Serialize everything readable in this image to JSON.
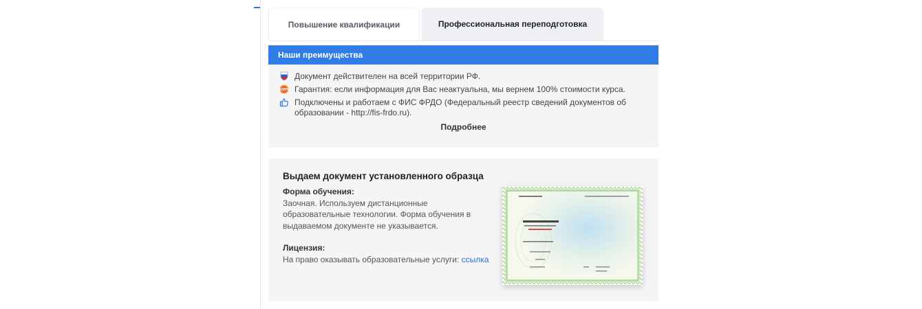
{
  "tabs": [
    {
      "label": "Повышение квалификации",
      "active": true
    },
    {
      "label": "Профессиональная переподготовка",
      "active": false
    }
  ],
  "advantages": {
    "title": "Наши преимущества",
    "items": [
      {
        "icon": "russia-flag-shield-icon",
        "text": "Документ действителен на всей территории РФ."
      },
      {
        "icon": "100-percent-badge-icon",
        "text": "Гарантия: если информация для Вас неактуальна, мы вернем 100% стоимости курса."
      },
      {
        "icon": "thumbs-up-icon",
        "text": "Подключены и работаем с ФИС ФРДО (Федеральный реестр сведений документов об образовании - http://fis-frdo.ru)."
      }
    ],
    "more_label": "Подробнее"
  },
  "document": {
    "title": "Выдаем документ установленного образца",
    "form_label": "Форма обучения:",
    "form_text": "Заочная. Используем дистанционные образовательные технологии. Форма обучения в выдаваемом документе не указывается.",
    "license_label": "Лицензия:",
    "license_text": "На право оказывать образовательные услуги:",
    "license_link": "ссылка"
  },
  "colors": {
    "accent": "#2f7ce6",
    "panel_bg": "#f5f5f6",
    "link": "#2a6fdb",
    "certificate_border": "#7fbf6a"
  }
}
